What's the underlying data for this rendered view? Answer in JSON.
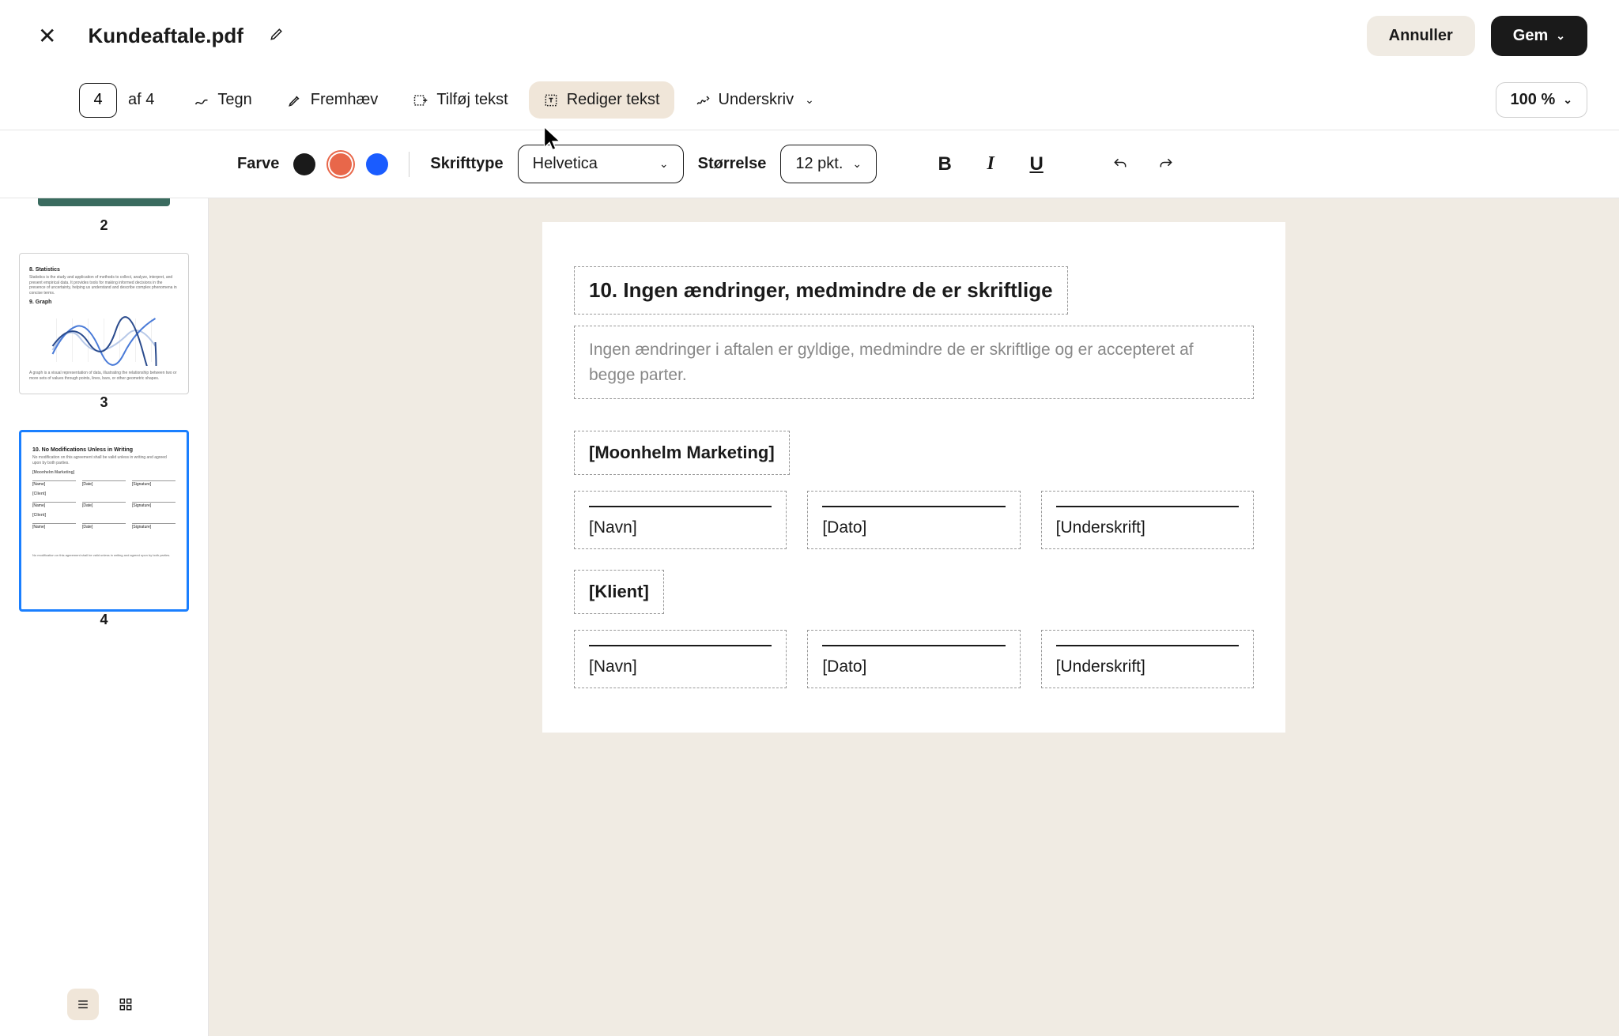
{
  "header": {
    "filename": "Kundeaftale.pdf",
    "cancel": "Annuller",
    "save": "Gem"
  },
  "toolbar": {
    "page_current": "4",
    "page_total": "af 4",
    "draw": "Tegn",
    "highlight": "Fremhæv",
    "add_text": "Tilføj tekst",
    "edit_text": "Rediger tekst",
    "sign": "Underskriv",
    "zoom": "100 %"
  },
  "format": {
    "color_label": "Farve",
    "font_label": "Skrifttype",
    "font_value": "Helvetica",
    "size_label": "Størrelse",
    "size_value": "12 pkt."
  },
  "thumbnails": {
    "p2_num": "2",
    "p3_num": "3",
    "p4_num": "4",
    "p3": {
      "h1": "8. Statistics",
      "t1": "Statistics is the study and application of methods to collect, analyze, interpret, and present empirical data. It provides tools for making informed decisions in the presence of uncertainty, helping us understand and describe complex phenomena in concise terms.",
      "h2": "9. Graph",
      "t2": "A graph is a visual representation of data, illustrating the relationship between two or more sets of values through points, lines, bars, or other geometric shapes."
    },
    "p4": {
      "h1": "10. No Modifications Unless in Writing",
      "t1": "No modification on this agreement shall be valid unless in writing and agreed upon by both parties.",
      "company": "[Moonhelm Marketing]",
      "client": "[Client]",
      "name": "[Name]",
      "date": "[Date]",
      "sig": "[Signature]",
      "footer": "No modification on this agreement shall be valid unless in writing and agreed upon by both parties."
    }
  },
  "document": {
    "heading": "10. Ingen ændringer, medmindre de er skriftlige",
    "body": "Ingen ændringer i aftalen er gyldige, medmindre de er skriftlige og er accepteret af begge parter.",
    "party1": "[Moonhelm Marketing]",
    "party2": "[Klient]",
    "name": "[Navn]",
    "date": "[Dato]",
    "signature": "[Underskrift]"
  }
}
